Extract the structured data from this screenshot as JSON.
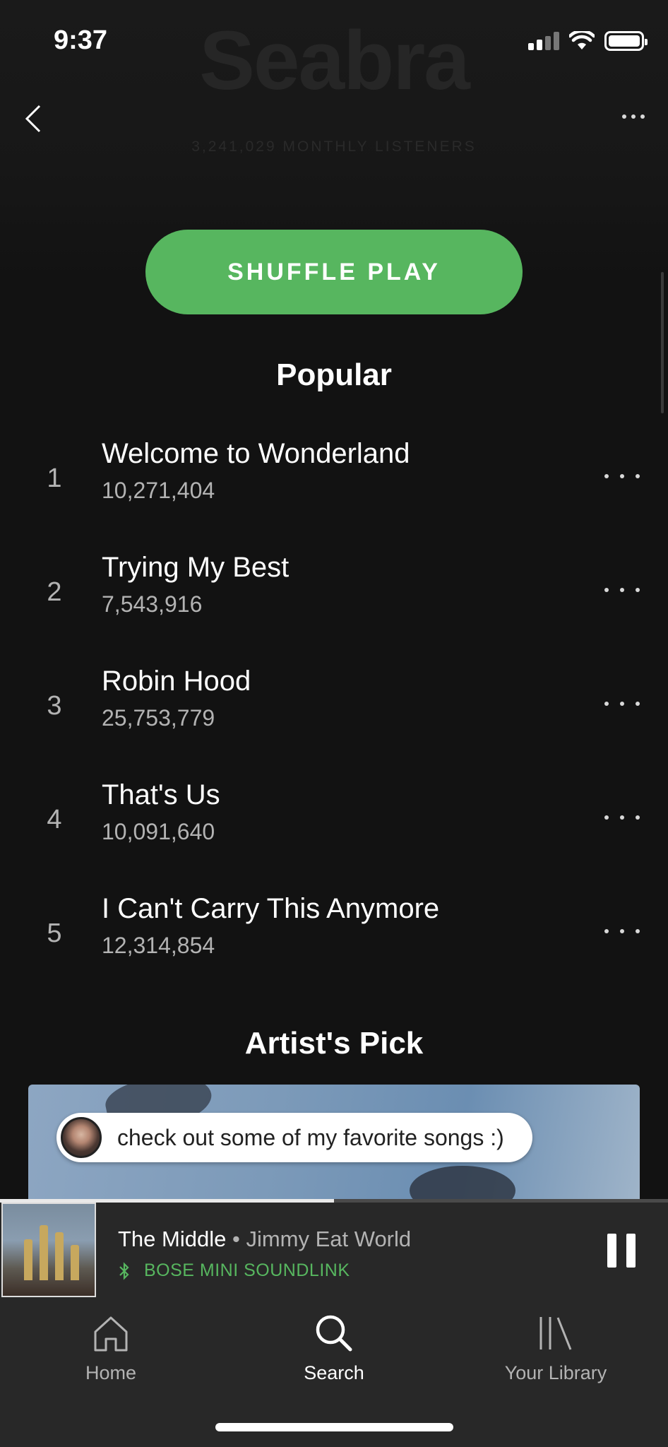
{
  "status": {
    "time": "9:37"
  },
  "artist": {
    "name": "Seabra",
    "listeners": "3,241,029 MONTHLY LISTENERS"
  },
  "actions": {
    "shuffle_label": "SHUFFLE PLAY"
  },
  "popular": {
    "title": "Popular",
    "tracks": [
      {
        "rank": "1",
        "title": "Welcome to Wonderland",
        "plays": "10,271,404"
      },
      {
        "rank": "2",
        "title": "Trying My Best",
        "plays": "7,543,916"
      },
      {
        "rank": "3",
        "title": "Robin Hood",
        "plays": "25,753,779"
      },
      {
        "rank": "4",
        "title": "That's Us",
        "plays": "10,091,640"
      },
      {
        "rank": "5",
        "title": "I Can't Carry This Anymore",
        "plays": "12,314,854"
      }
    ]
  },
  "artists_pick": {
    "title": "Artist's Pick",
    "message": "check out some of my favorite songs :)"
  },
  "now_playing": {
    "track": "The Middle",
    "separator": " • ",
    "artist": "Jimmy Eat World",
    "device": "BOSE MINI SOUNDLINK",
    "progress": 0.5
  },
  "tabs": [
    {
      "label": "Home",
      "icon": "home-icon",
      "active": false
    },
    {
      "label": "Search",
      "icon": "search-icon",
      "active": true
    },
    {
      "label": "Your Library",
      "icon": "library-icon",
      "active": false
    }
  ],
  "colors": {
    "accent": "#57b65f",
    "background": "#121212",
    "player": "#282828"
  }
}
